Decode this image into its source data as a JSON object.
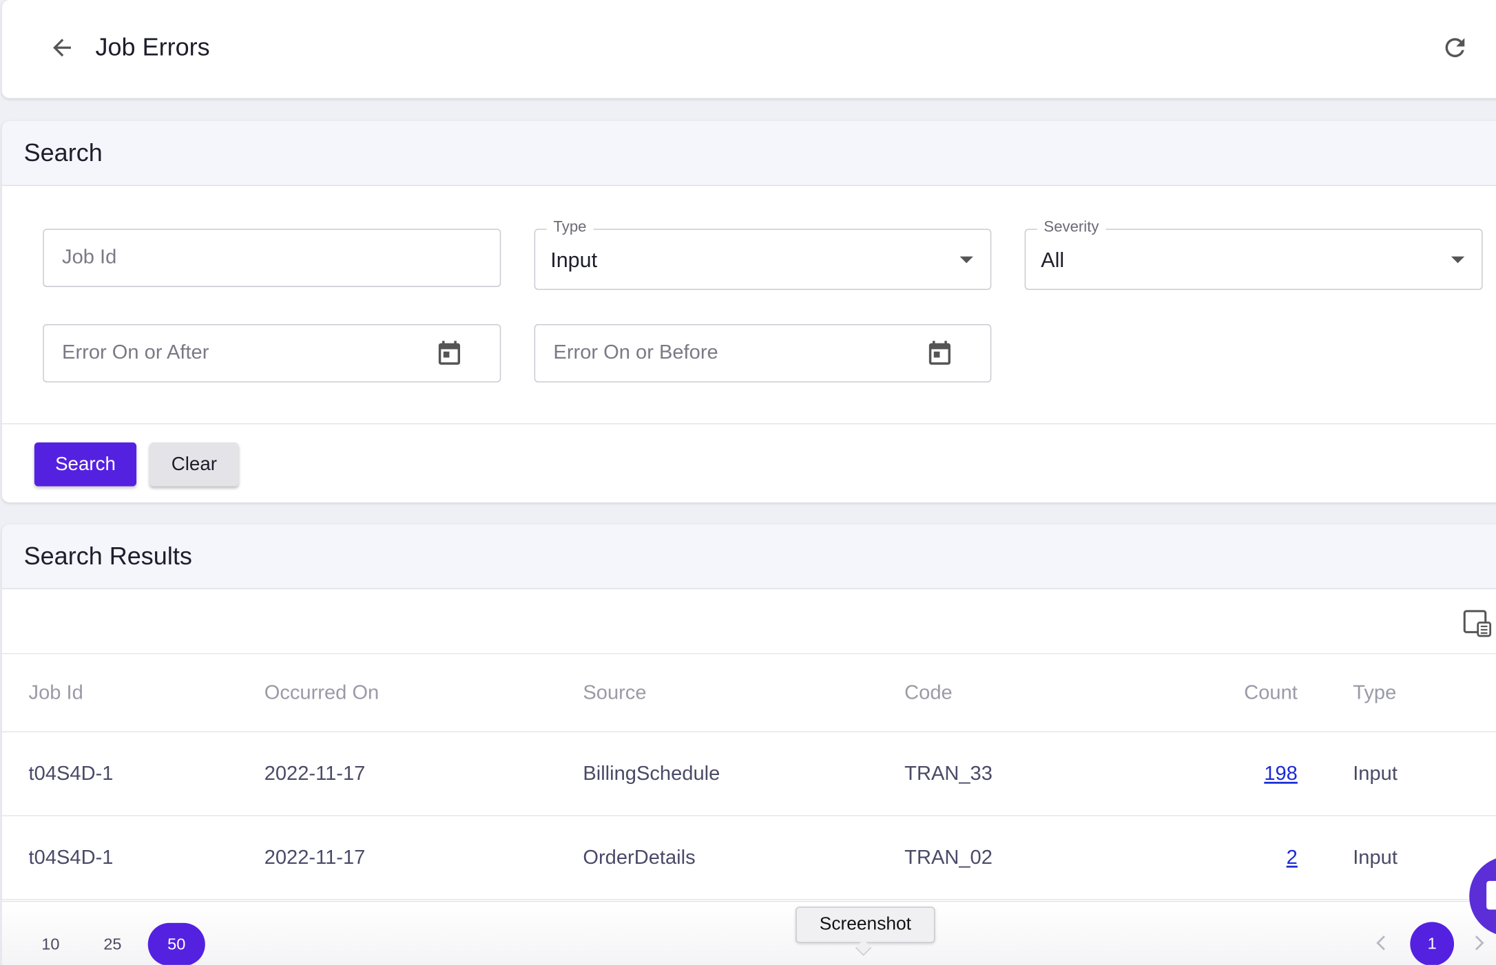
{
  "header": {
    "title": "Job Errors"
  },
  "search": {
    "title": "Search",
    "job_id_placeholder": "Job Id",
    "type_label": "Type",
    "type_value": "Input",
    "severity_label": "Severity",
    "severity_value": "All",
    "after_placeholder": "Error On or After",
    "before_placeholder": "Error On or Before",
    "search_button": "Search",
    "clear_button": "Clear"
  },
  "results": {
    "title": "Search Results",
    "columns": [
      "Job Id",
      "Occurred On",
      "Source",
      "Code",
      "Count",
      "Type"
    ],
    "rows": [
      {
        "job_id": "t04S4D-1",
        "occurred_on": "2022-11-17",
        "source": "BillingSchedule",
        "code": "TRAN_33",
        "count": "198",
        "type": "Input"
      },
      {
        "job_id": "t04S4D-1",
        "occurred_on": "2022-11-17",
        "source": "OrderDetails",
        "code": "TRAN_02",
        "count": "2",
        "type": "Input"
      }
    ]
  },
  "pagination": {
    "page_sizes": [
      "10",
      "25",
      "50"
    ],
    "active_page_size": "50",
    "current_page": "1"
  },
  "tooltip": {
    "text": "Screenshot"
  },
  "colors": {
    "accent": "#5521e0",
    "link": "#1a2ad8"
  }
}
